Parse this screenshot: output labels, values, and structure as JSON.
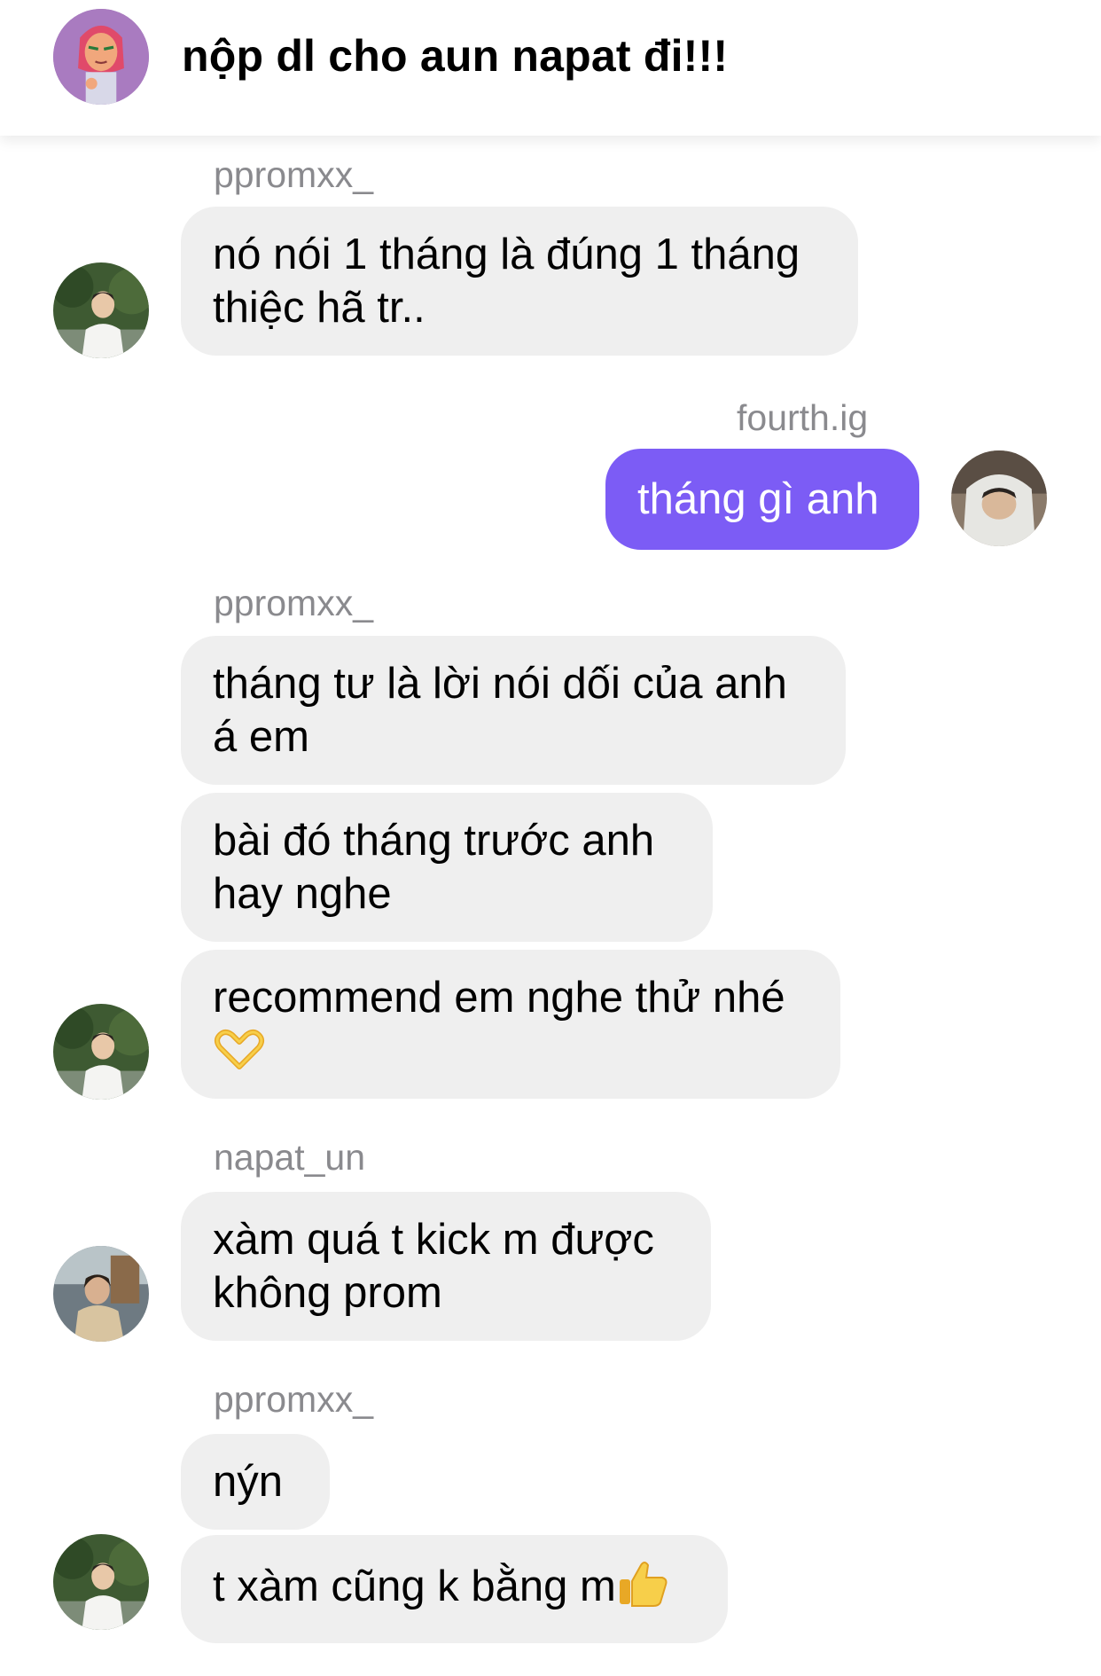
{
  "header": {
    "title": "nộp dl cho aun napat đi!!!",
    "avatar_icon": "group-avatar-cartoon"
  },
  "messages": [
    {
      "sender": "ppromxx_",
      "direction": "incoming",
      "lines": [
        "nó nói 1 tháng là đúng 1 tháng",
        "thiệc hã tr.."
      ]
    },
    {
      "sender": "fourth.ig",
      "direction": "outgoing",
      "lines": [
        "tháng gì anh"
      ]
    },
    {
      "sender": "ppromxx_",
      "direction": "incoming",
      "lines": [
        "tháng tư là lời nói dối của anh",
        "á em"
      ]
    },
    {
      "sender": "ppromxx_",
      "direction": "incoming",
      "lines": [
        "bài đó tháng trước anh",
        "hay nghe"
      ]
    },
    {
      "sender": "ppromxx_",
      "direction": "incoming",
      "lines": [
        "recommend em nghe thử nhé",
        ""
      ],
      "emoji": "heart-hands-emoji"
    },
    {
      "sender": "napat_un",
      "direction": "incoming",
      "lines": [
        "xàm quá t kick m được",
        "không prom"
      ]
    },
    {
      "sender": "ppromxx_",
      "direction": "incoming",
      "lines": [
        "nýn"
      ]
    },
    {
      "sender": "ppromxx_",
      "direction": "incoming",
      "lines": [
        "t xàm cũng k bằng m"
      ],
      "emoji": "thumbs-up-emoji"
    }
  ],
  "usernames": [
    "ppromxx_",
    "fourth.ig",
    "ppromxx_",
    "napat_un",
    "ppromxx_"
  ],
  "colors": {
    "outgoing_bubble": "#7c5cf5",
    "incoming_bubble": "#efefef",
    "username_text": "#8a8a8e"
  }
}
